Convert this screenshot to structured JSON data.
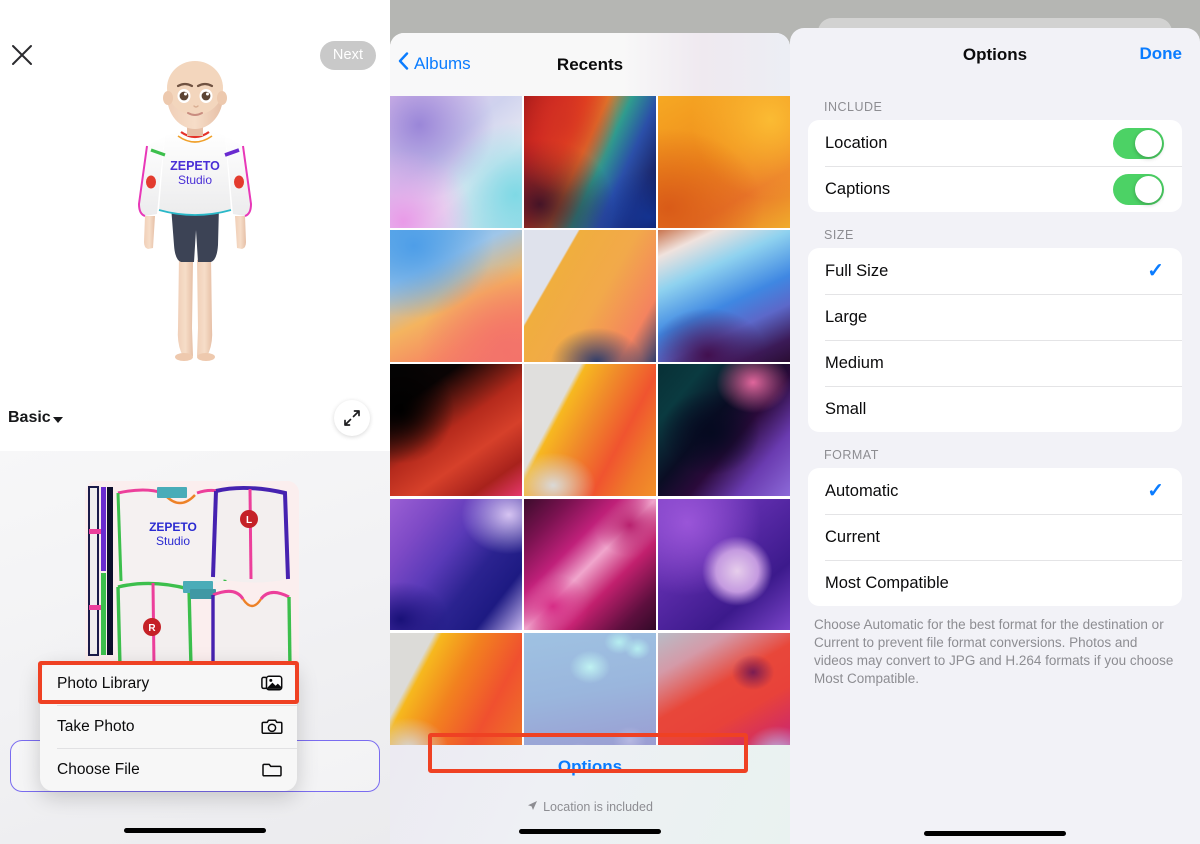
{
  "left_panel": {
    "close_icon": "close-x-icon",
    "next_label": "Next",
    "avatar_brand_line1": "ZEPETO",
    "avatar_brand_line2": "Studio",
    "category_label": "Basic",
    "expand_icon": "expand-arrows-icon",
    "garment_brand_line1": "ZEPETO",
    "garment_brand_line2": "Studio",
    "garment_marker_left": "L",
    "garment_marker_right": "R",
    "action_menu": [
      {
        "label": "Photo Library",
        "icon": "photo-stack-icon",
        "highlighted": true
      },
      {
        "label": "Take Photo",
        "icon": "camera-icon",
        "highlighted": false
      },
      {
        "label": "Choose File",
        "icon": "folder-icon",
        "highlighted": false
      }
    ]
  },
  "mid_panel": {
    "back_label": "Albums",
    "back_icon": "chevron-left-icon",
    "title": "Recents",
    "options_label": "Options",
    "location_note": "Location is included",
    "location_icon": "location-arrow-icon",
    "photos": [
      {
        "id": "photo-1",
        "alt": "pastel purple and teal gradient"
      },
      {
        "id": "photo-2",
        "alt": "deep red and rainbow ribbon gradient"
      },
      {
        "id": "photo-3",
        "alt": "orange and amber gradient"
      },
      {
        "id": "photo-4",
        "alt": "blue to orange gradient"
      },
      {
        "id": "photo-5",
        "alt": "amber curve on light gray"
      },
      {
        "id": "photo-6",
        "alt": "blue and purple wave gradient"
      },
      {
        "id": "photo-7",
        "alt": "dark red on black gradient"
      },
      {
        "id": "photo-8",
        "alt": "orange and pink on gray gradient"
      },
      {
        "id": "photo-9",
        "alt": "teal and magenta dark gradient"
      },
      {
        "id": "photo-10",
        "alt": "violet wave gradient"
      },
      {
        "id": "photo-11",
        "alt": "magenta hourglass gradient"
      },
      {
        "id": "photo-12",
        "alt": "purple sphere gradient"
      },
      {
        "id": "photo-13",
        "alt": "orange and coral on gray gradient"
      },
      {
        "id": "photo-14",
        "alt": "light blue bokeh"
      },
      {
        "id": "photo-15",
        "alt": "red and pink abstract"
      }
    ]
  },
  "right_panel": {
    "title": "Options",
    "done_label": "Done",
    "sections": [
      {
        "header": "INCLUDE",
        "type": "toggles",
        "rows": [
          {
            "label": "Location",
            "on": true
          },
          {
            "label": "Captions",
            "on": true
          }
        ]
      },
      {
        "header": "SIZE",
        "type": "choice",
        "rows": [
          {
            "label": "Full Size",
            "selected": true
          },
          {
            "label": "Large",
            "selected": false
          },
          {
            "label": "Medium",
            "selected": false
          },
          {
            "label": "Small",
            "selected": false
          }
        ]
      },
      {
        "header": "FORMAT",
        "type": "choice",
        "rows": [
          {
            "label": "Automatic",
            "selected": true
          },
          {
            "label": "Current",
            "selected": false
          },
          {
            "label": "Most Compatible",
            "selected": false
          }
        ]
      }
    ],
    "footnote": "Choose Automatic for the best format for the destination or Current to prevent file format conversions. Photos and videos may convert to JPG and H.264 formats if you choose Most Compatible.",
    "checkmark_glyph": "✓"
  },
  "colors": {
    "ios_blue": "#0a7cff",
    "toggle_green": "#4cd265",
    "highlight_red": "#ef4123",
    "zepeto_purple": "#4a2fd6",
    "upload_border_purple": "#7a6cf0"
  }
}
